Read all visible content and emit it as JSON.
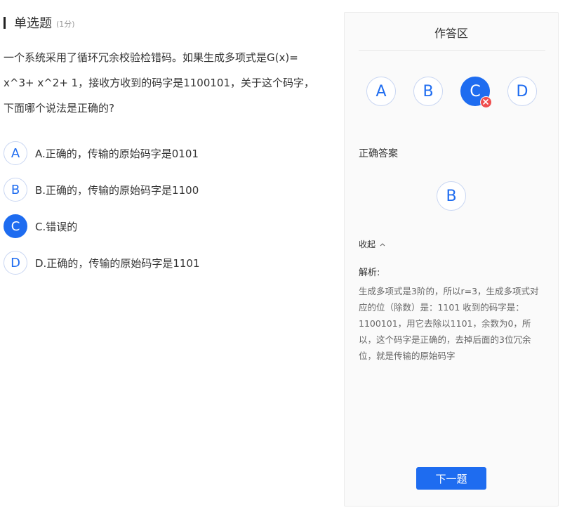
{
  "question": {
    "type_label": "单选题",
    "score": "(1分)",
    "text": "一个系统采用了循环冗余校验检错码。如果生成多项式是G(x)= x^3+ x^2+ 1，接收方收到的码字是1100101，关于这个码字，下面哪个说法是正确的?",
    "options": [
      {
        "letter": "A",
        "text": "A.正确的，传输的原始码字是0101"
      },
      {
        "letter": "B",
        "text": "B.正确的，传输的原始码字是1100"
      },
      {
        "letter": "C",
        "text": "C.错误的"
      },
      {
        "letter": "D",
        "text": "D.正确的，传输的原始码字是1101"
      }
    ],
    "selected": "C"
  },
  "panel": {
    "title": "作答区",
    "answer_choices": [
      "A",
      "B",
      "C",
      "D"
    ],
    "correct_label": "正确答案",
    "correct_answer": "B",
    "collapse_label": "收起",
    "analysis_label": "解析:",
    "analysis_text": "生成多项式是3阶的，所以r=3，生成多项式对应的位（除数）是：1101 收到的码字是：1100101，用它去除以1101，余数为0，所以，这个码字是正确的，去掉后面的3位冗余位，就是传输的原始码字",
    "next_label": "下一题"
  },
  "colors": {
    "accent": "#1e6cf0",
    "wrong": "#ef4d4d"
  },
  "icons": {
    "wrong_mark": "close-icon",
    "collapse": "chevron-up-icon"
  }
}
